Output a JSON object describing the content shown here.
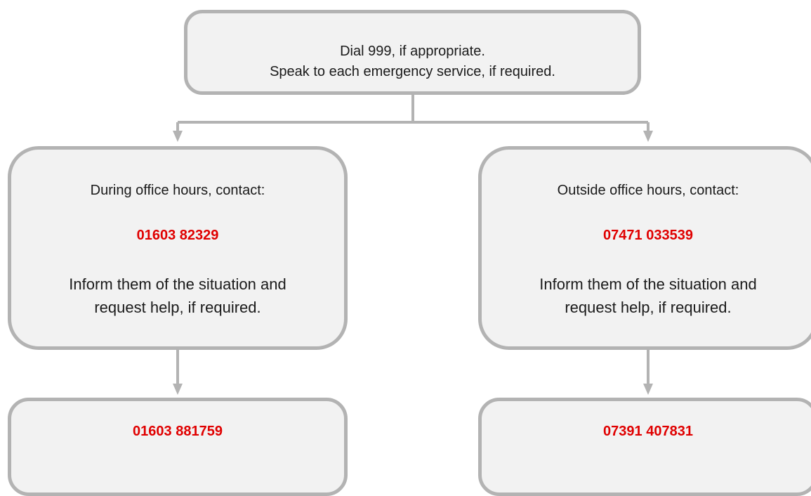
{
  "colors": {
    "box_fill": "#f2f2f2",
    "box_border": "#b3b3b3",
    "connector": "#b3b3b3",
    "phone_text": "#e00000",
    "body_text": "#1a1a1a"
  },
  "top_box": {
    "line1": "Dial 999, if appropriate.",
    "line2": "Speak to each emergency service, if required."
  },
  "left_box": {
    "heading": "During office hours, contact:",
    "phone": "01603 82329",
    "line1": "Inform them of the situation and",
    "line2": "request help, if required."
  },
  "right_box": {
    "heading": "Outside office hours, contact:",
    "phone": "07471 033539",
    "line1": "Inform them of the situation and",
    "line2": "request help, if required."
  },
  "bottom_left_box": {
    "phone": "01603 881759"
  },
  "bottom_right_box": {
    "phone": "07391 407831"
  }
}
